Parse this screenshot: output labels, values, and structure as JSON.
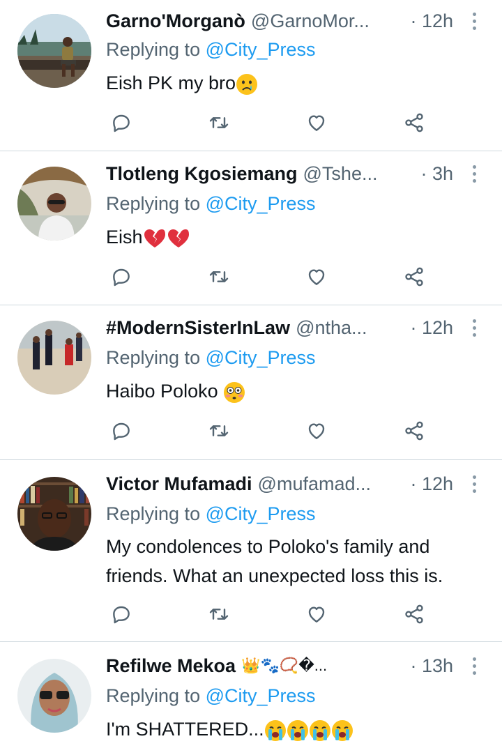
{
  "tweets": [
    {
      "name": "Garno'Morganò",
      "handle": "@GarnoMor...",
      "time": "· 12h",
      "replying_prefix": "Replying to ",
      "replying_mention": "@City_Press",
      "text": "Eish PK my bro",
      "emoji": [
        "crying-face"
      ],
      "avatar": "man-sitting-beach"
    },
    {
      "name": "Tlotleng Kgosiemang",
      "handle": "@Tshe...",
      "time": "· 3h",
      "replying_prefix": "Replying to ",
      "replying_mention": "@City_Press",
      "text": "Eish",
      "emoji": [
        "broken-heart",
        "broken-heart"
      ],
      "avatar": "man-sunglasses-tree"
    },
    {
      "name": "#ModernSisterInLaw",
      "handle": "@ntha...",
      "time": "· 12h",
      "replying_prefix": "Replying to ",
      "replying_mention": "@City_Press",
      "text": "Haibo Poloko ",
      "emoji": [
        "flushed-face"
      ],
      "avatar": "people-walking"
    },
    {
      "name": "Victor Mufamadi",
      "handle": "@mufamad...",
      "time": "· 12h",
      "replying_prefix": "Replying to ",
      "replying_mention": "@City_Press",
      "text": "My condolences to Poloko's family and friends. What an unexpected loss this is.",
      "emoji": [],
      "avatar": "man-bookshelf"
    },
    {
      "name": "Refilwe Mekoa",
      "handle": "",
      "name_emoji": "👑🐾📿�...",
      "time": "· 13h",
      "replying_prefix": "Replying to ",
      "replying_mention": "@City_Press",
      "text": "I'm SHATTERED...",
      "emoji": [
        "loudly-crying-face",
        "loudly-crying-face",
        "loudly-crying-face",
        "loudly-crying-face"
      ],
      "avatar": "woman-sunglasses"
    }
  ],
  "icons": {
    "reply": "reply-icon",
    "retweet": "retweet-icon",
    "like": "like-icon",
    "share": "share-icon",
    "more": "more-icon"
  },
  "colors": {
    "link": "#1d9bf0",
    "secondary": "#536471",
    "divider": "#cfd9de",
    "icon": "#536471"
  }
}
